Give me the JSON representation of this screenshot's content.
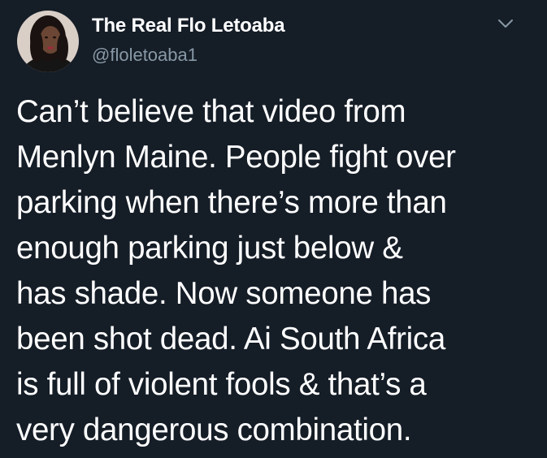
{
  "author": {
    "display_name": "The Real Flo Letoaba",
    "handle": "@floletoaba1"
  },
  "tweet": {
    "lines": [
      "Can’t believe that video from",
      "Menlyn Maine. People fight over",
      "parking when there’s more than",
      "enough parking just below &",
      "has shade. Now someone has",
      "been shot dead. Ai South Africa",
      "is full of violent fools & that’s a",
      "very dangerous combination."
    ]
  },
  "icons": {
    "menu": "chevron-down-icon"
  },
  "colors": {
    "background": "#151d27",
    "text": "#ffffff",
    "secondary_text": "#8899a6"
  }
}
